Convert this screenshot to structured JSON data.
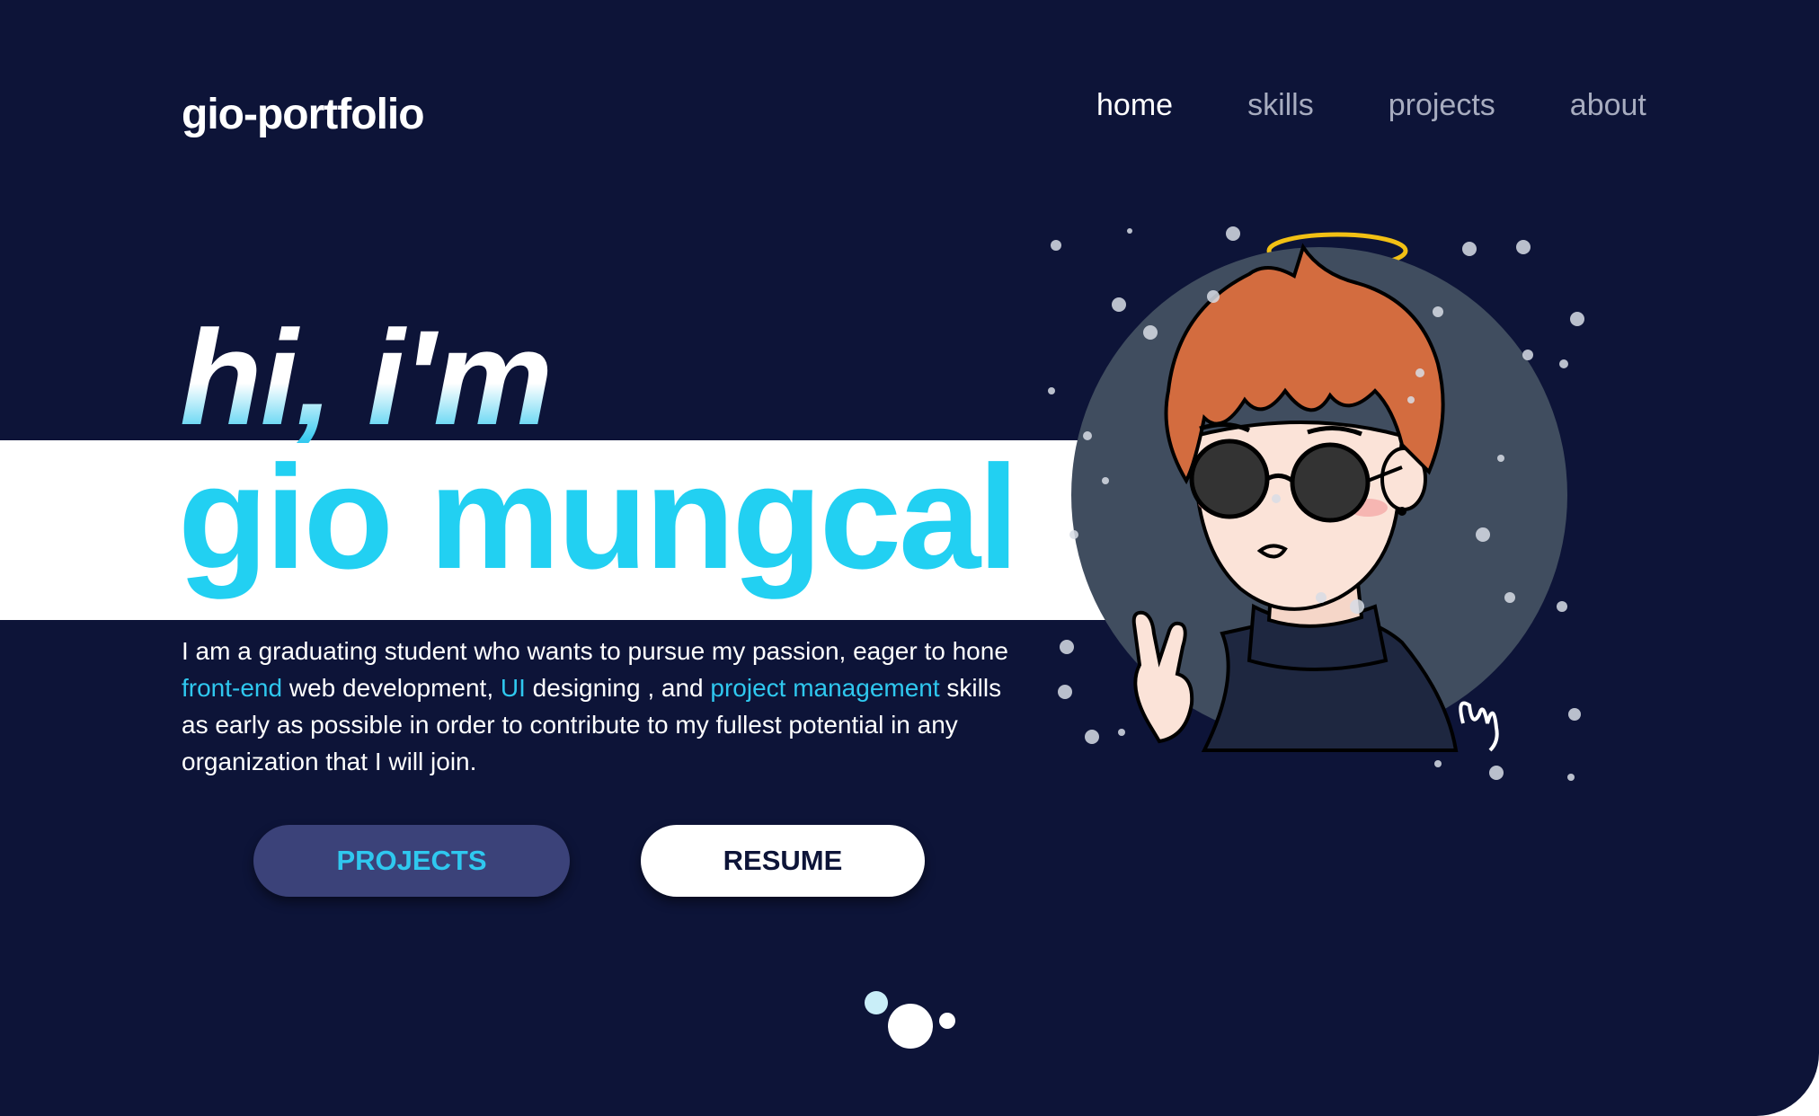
{
  "header": {
    "logo": "gio-portfolio",
    "nav": [
      "home",
      "skills",
      "projects",
      "about"
    ],
    "active_nav": "home"
  },
  "hero": {
    "greeting": "hi, i'm",
    "name": "gio mungcal",
    "bio": [
      {
        "text": "I am a graduating student who wants to pursue my passion, eager to hone ",
        "hl": false
      },
      {
        "text": "front-end",
        "hl": true
      },
      {
        "text": " web development, ",
        "hl": false
      },
      {
        "text": "UI",
        "hl": true
      },
      {
        "text": " designing , and ",
        "hl": false
      },
      {
        "text": "project management",
        "hl": true
      },
      {
        "text": " skills as early as possible in order to contribute to my fullest potential in any organization that I will join.",
        "hl": false
      }
    ],
    "buttons": {
      "projects": "PROJECTS",
      "resume": "RESUME"
    }
  },
  "colors": {
    "background": "#0d1438",
    "accent": "#22d0f2",
    "button_dark": "#3b4279",
    "white": "#ffffff"
  },
  "icons": {
    "avatar": "cartoon-avatar-with-halo",
    "scroll_indicator": "scroll-dots-icon"
  }
}
